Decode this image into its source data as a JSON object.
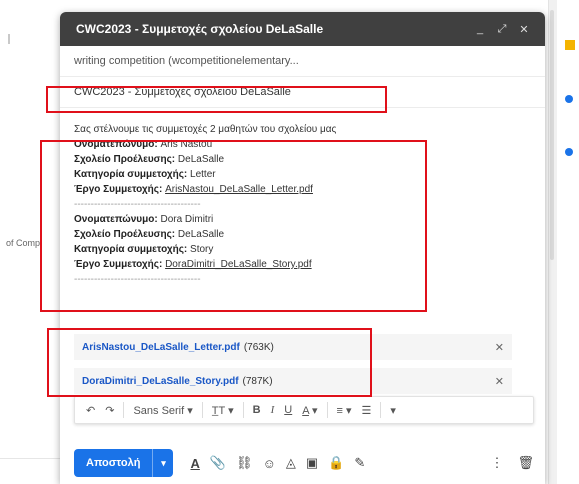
{
  "background": {
    "left_text": "of Comp"
  },
  "compose": {
    "title": "CWC2023 - Συμμετοχές σχολείου DeLaSalle",
    "controls": {
      "minimize": "_",
      "expand": "⤢",
      "close": "✕"
    },
    "recipients": "writing competition (wcompetitionelementary...",
    "subject": "CWC2023 - Συμμετοχές σχολείου DeLaSalle",
    "intro": "Σας στέλνουμε τις συμμετοχές 2 μαθητών του σχολείου μας",
    "separator": "--------------------------------------",
    "entries": [
      {
        "name_label": "Ονοματεπώνυμο:",
        "name": "Aris Nastou",
        "school_label": "Σχολείο Προέλευσης:",
        "school": "DeLaSalle",
        "category_label": "Κατηγορία συμμετοχής:",
        "category": "Letter",
        "work_label": "Έργο Συμμετοχής:",
        "work": "ArisNastou_DeLaSalle_Letter.pdf"
      },
      {
        "name_label": "Ονοματεπώνυμο:",
        "name": "Dora Dimitri",
        "school_label": "Σχολείο Προέλευσης:",
        "school": "DeLaSalle",
        "category_label": "Κατηγορία συμμετοχής:",
        "category": "Story",
        "work_label": "Έργο Συμμετοχής:",
        "work": "DoraDimitri_DeLaSalle_Story.pdf"
      }
    ],
    "attachments": [
      {
        "name": "ArisNastou_DeLaSalle_Letter.pdf",
        "size": "(763K)"
      },
      {
        "name": "DoraDimitri_DeLaSalle_Story.pdf",
        "size": "(787K)"
      }
    ],
    "toolbar": {
      "undo": "↶",
      "redo": "↷",
      "font": "Sans Serif",
      "font_dd": "▾",
      "size": "T̲T",
      "size_dd": "▾",
      "bold": "B",
      "italic": "I",
      "underline": "U",
      "color": "A",
      "color_dd": "▾",
      "align": "≡",
      "align_dd": "▾",
      "list": "☰",
      "more": "▾"
    },
    "send_label": "Αποστολή",
    "send_dropdown": "▾",
    "bottom_icons": {
      "format": "A",
      "attach": "📎",
      "link": "⛓",
      "emoji": "☺",
      "drive": "◬",
      "photo": "▣",
      "lock": "🔒",
      "sign": "✎",
      "more": "⋮",
      "delete": "🗑"
    },
    "highlight_color": "#e0101a",
    "accent": "#1a73e8"
  }
}
